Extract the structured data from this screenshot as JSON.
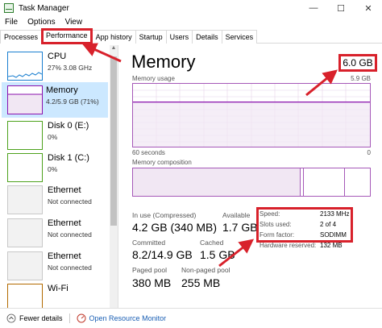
{
  "window": {
    "title": "Task Manager",
    "minimize": "—",
    "maximize": "☐",
    "close": "✕"
  },
  "menu": [
    "File",
    "Options",
    "View"
  ],
  "tabs": [
    "Processes",
    "Performance",
    "App history",
    "Startup",
    "Users",
    "Details",
    "Services"
  ],
  "active_tab": "Performance",
  "sidebar": [
    {
      "name": "CPU",
      "sub": "27%  3.08 GHz"
    },
    {
      "name": "Memory",
      "sub": "4.2/5.9 GB (71%)"
    },
    {
      "name": "Disk 0 (E:)",
      "sub": "0%"
    },
    {
      "name": "Disk 1 (C:)",
      "sub": "0%"
    },
    {
      "name": "Ethernet",
      "sub": "Not connected"
    },
    {
      "name": "Ethernet",
      "sub": "Not connected"
    },
    {
      "name": "Ethernet",
      "sub": "Not connected"
    },
    {
      "name": "Wi-Fi",
      "sub": ""
    }
  ],
  "main": {
    "title": "Memory",
    "total": "6.0 GB",
    "usage_label": "Memory usage",
    "usage_max": "5.9 GB",
    "time_label": "60 seconds",
    "time_end": "0",
    "composition_label": "Memory composition",
    "usage_fraction": 0.71,
    "stats": {
      "in_use_label": "In use (Compressed)",
      "in_use_value": "4.2 GB (340 MB)",
      "available_label": "Available",
      "available_value": "1.7 GB",
      "committed_label": "Committed",
      "committed_value": "8.2/14.9 GB",
      "cached_label": "Cached",
      "cached_value": "1.5 GB",
      "paged_label": "Paged pool",
      "paged_value": "380 MB",
      "nonpaged_label": "Non-paged pool",
      "nonpaged_value": "255 MB"
    },
    "specs": {
      "speed_label": "Speed:",
      "speed_value": "2133 MHz",
      "slots_label": "Slots used:",
      "slots_value": "2 of 4",
      "form_label": "Form factor:",
      "form_value": "SODIMM",
      "reserved_label": "Hardware reserved:",
      "reserved_value": "132 MB"
    }
  },
  "footer": {
    "fewer": "Fewer details",
    "monitor": "Open Resource Monitor"
  },
  "colors": {
    "annotation": "#d8212b",
    "memory": "#8b12ae",
    "link": "#1a5fb4"
  }
}
